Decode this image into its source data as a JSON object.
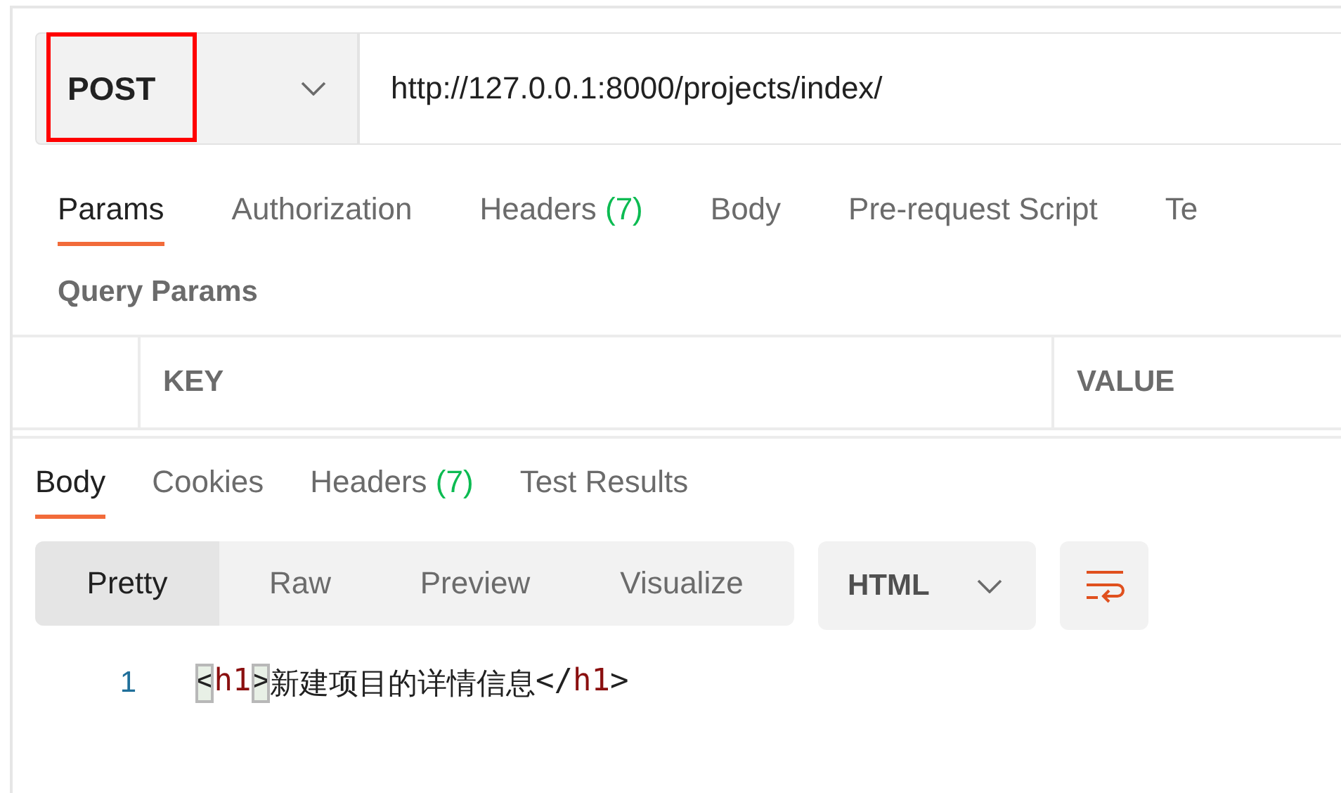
{
  "request": {
    "method": "POST",
    "method_highlighted": true,
    "url": "http://127.0.0.1:8000/projects/index/"
  },
  "request_tabs": [
    {
      "label": "Params",
      "selected": true
    },
    {
      "label": "Authorization",
      "selected": false
    },
    {
      "label": "Headers",
      "count": "(7)",
      "selected": false
    },
    {
      "label": "Body",
      "selected": false
    },
    {
      "label": "Pre-request Script",
      "selected": false
    },
    {
      "label": "Te",
      "selected": false
    }
  ],
  "query_params": {
    "title": "Query Params",
    "columns": [
      "KEY",
      "VALUE"
    ]
  },
  "response_tabs": [
    {
      "label": "Body",
      "selected": true
    },
    {
      "label": "Cookies",
      "selected": false
    },
    {
      "label": "Headers",
      "count": "(7)",
      "selected": false
    },
    {
      "label": "Test Results",
      "selected": false
    }
  ],
  "view_modes": [
    {
      "label": "Pretty",
      "selected": true
    },
    {
      "label": "Raw",
      "selected": false
    },
    {
      "label": "Preview",
      "selected": false
    },
    {
      "label": "Visualize",
      "selected": false
    }
  ],
  "format": "HTML",
  "wrap_lines": true,
  "code_lines": [
    {
      "number": "1",
      "tokens": [
        {
          "kind": "punct",
          "text": "<",
          "matched": true
        },
        {
          "kind": "tag",
          "text": "h1",
          "matched": false
        },
        {
          "kind": "punct",
          "text": ">",
          "matched": true
        },
        {
          "kind": "text",
          "text": "新建项目的详情信息",
          "matched": false
        },
        {
          "kind": "punct",
          "text": "</",
          "matched": false
        },
        {
          "kind": "tag",
          "text": "h1",
          "matched": false
        },
        {
          "kind": "punct",
          "text": ">",
          "matched": false
        }
      ]
    }
  ]
}
